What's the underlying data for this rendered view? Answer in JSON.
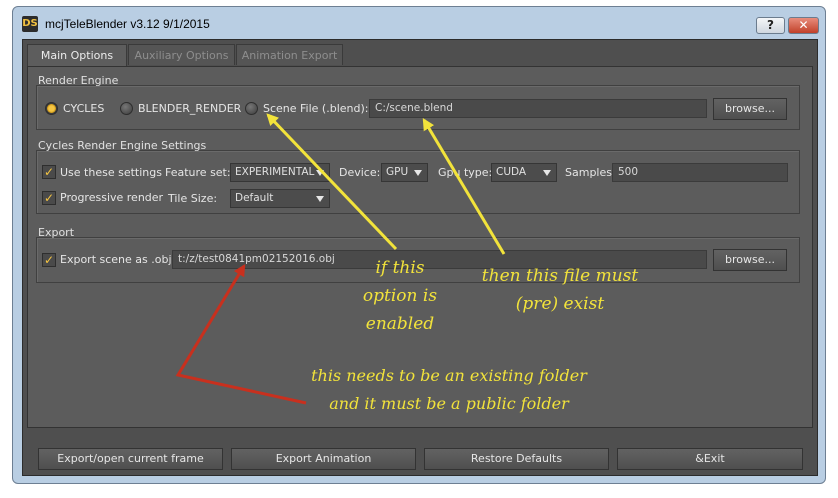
{
  "window": {
    "app_icon_text": "DS",
    "title": "mcjTeleBlender v3.12 9/1/2015",
    "help_label": "?",
    "close_label": "✕"
  },
  "tabs": [
    {
      "label": "Main Options",
      "active": true
    },
    {
      "label": "Auxiliary Options",
      "active": false
    },
    {
      "label": "Animation Export",
      "active": false
    }
  ],
  "render_engine": {
    "group_label": "Render Engine",
    "options": [
      {
        "label": "CYCLES",
        "selected": true
      },
      {
        "label": "BLENDER_RENDER",
        "selected": false
      },
      {
        "label": "Scene File (.blend):",
        "selected": false
      }
    ],
    "scene_file_value": "C:/scene.blend",
    "browse_label": "browse..."
  },
  "cycles_settings": {
    "group_label": "Cycles Render Engine Settings",
    "use_settings_label": "Use these settings",
    "use_settings_checked": true,
    "progressive_label": "Progressive render",
    "progressive_checked": true,
    "feature_set_label": "Feature set:",
    "feature_set_value": "EXPERIMENTAL",
    "device_label": "Device:",
    "device_value": "GPU",
    "gpu_type_label": "Gpu type:",
    "gpu_type_value": "CUDA",
    "samples_label": "Samples",
    "samples_value": "500",
    "tile_size_label": "Tile Size:",
    "tile_size_value": "Default"
  },
  "export": {
    "group_label": "Export",
    "export_obj_label": "Export scene as .obj",
    "export_obj_checked": true,
    "path_value": "t:/z/test0841pm02152016.obj",
    "browse_label": "browse..."
  },
  "annotations": {
    "note1_lines": [
      "if this",
      "option is",
      "enabled"
    ],
    "note2_lines": [
      "then this file must",
      "(pre) exist"
    ],
    "note3_lines": [
      "this needs to be an existing folder",
      "and it must be a public folder"
    ],
    "colors": {
      "yellow": "#f2e33b",
      "red": "#c8301e"
    }
  },
  "footer_buttons": [
    {
      "label": "Export/open current frame"
    },
    {
      "label": "Export Animation"
    },
    {
      "label": "Restore Defaults"
    },
    {
      "label": "&Exit"
    }
  ]
}
